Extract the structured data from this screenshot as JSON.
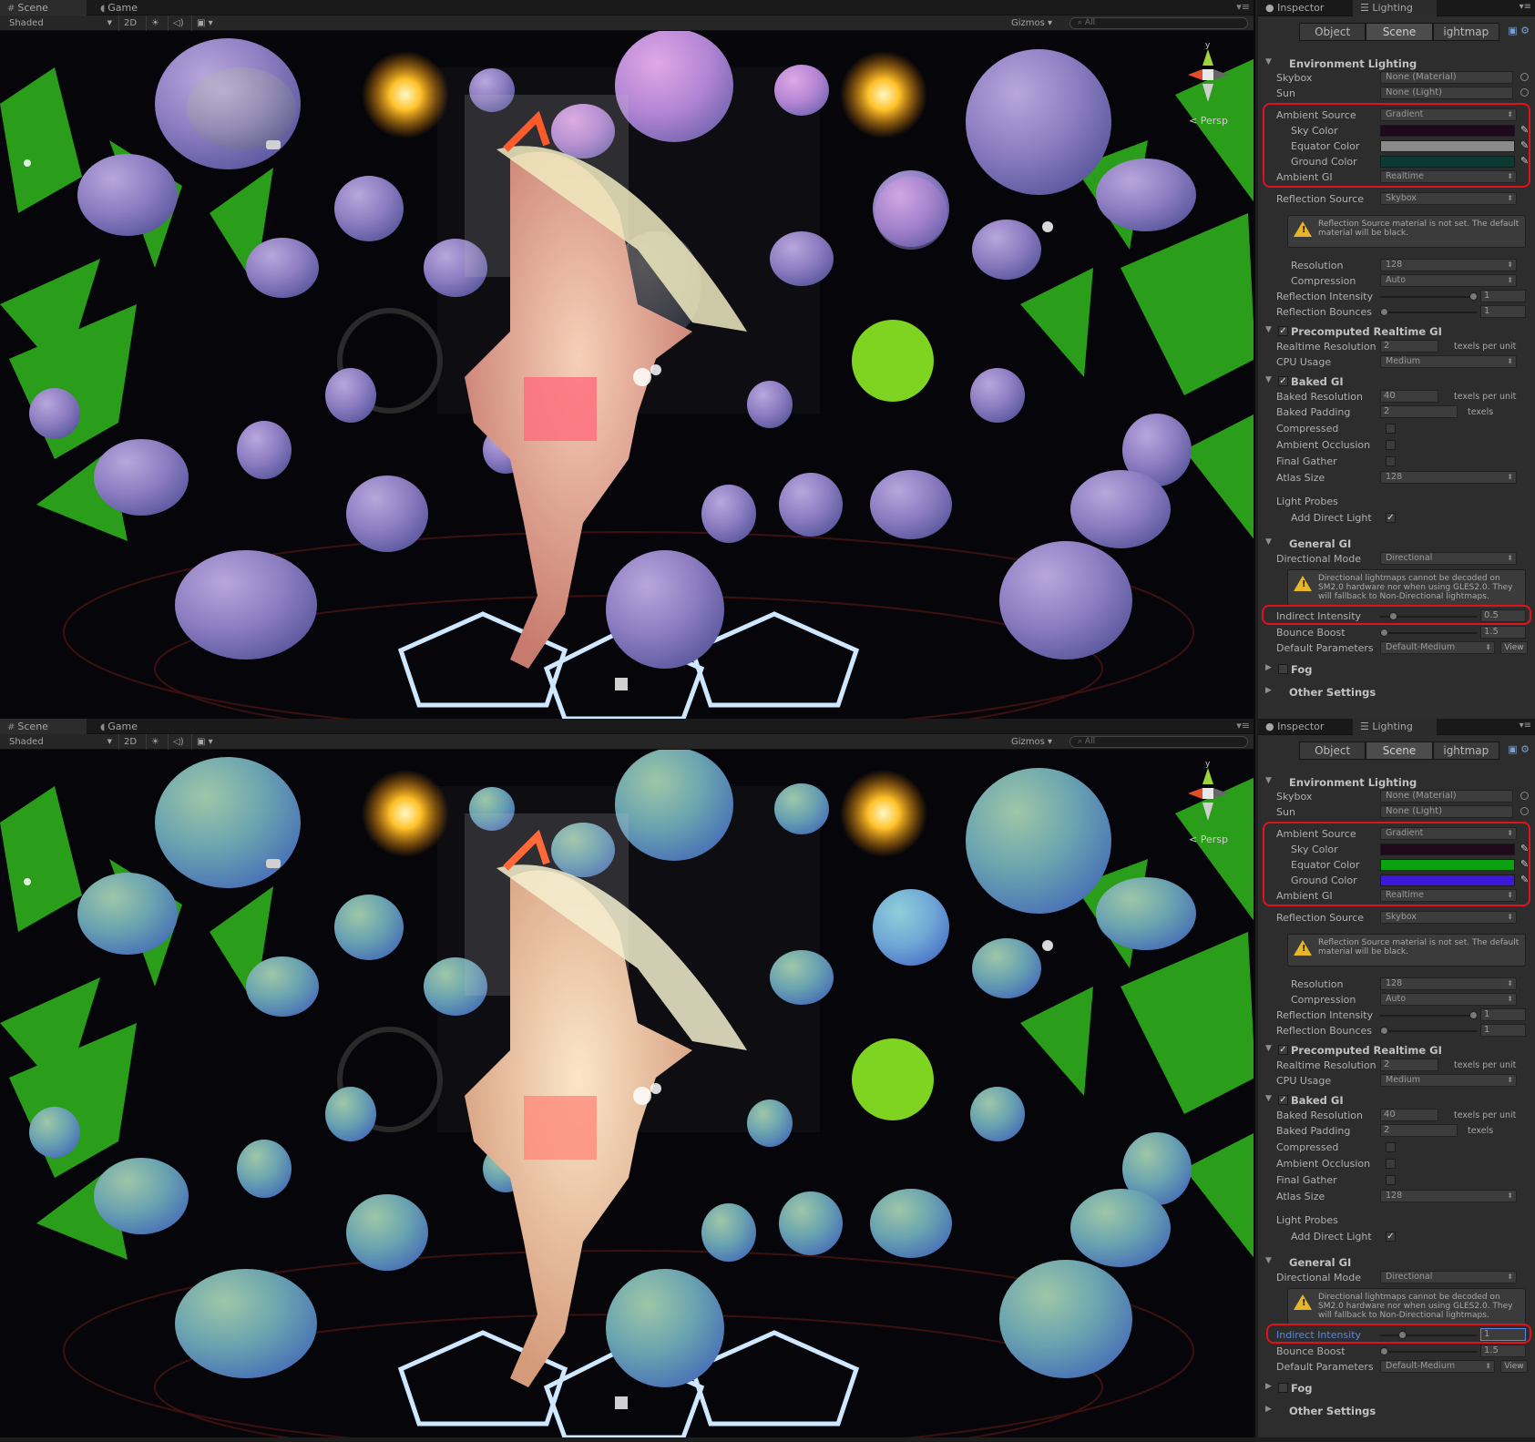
{
  "scene": {
    "tab_scene": "Scene",
    "tab_game": "Game",
    "shading_mode": "Shaded",
    "mode_2d": "2D",
    "gizmos_label": "Gizmos",
    "search_placeholder": "All",
    "persp_label": "Persp",
    "gizmo_axis_y": "y"
  },
  "panels": [
    {
      "tab_inspector": "Inspector",
      "tab_lighting": "Lighting",
      "seg_object": "Object",
      "seg_scene": "Scene",
      "seg_lightmap": "ightmap",
      "environment_header": "Environment Lighting",
      "skybox_label": "Skybox",
      "skybox_value": "None (Material)",
      "sun_label": "Sun",
      "sun_value": "None (Light)",
      "ambient_source_label": "Ambient Source",
      "ambient_source_value": "Gradient",
      "sky_color_label": "Sky Color",
      "sky_color": "#1e0a1a",
      "equator_color_label": "Equator Color",
      "equator_color": "#8a8a8a",
      "ground_color_label": "Ground Color",
      "ground_color": "#0a3a33",
      "ambient_gi_label": "Ambient GI",
      "ambient_gi_value": "Realtime",
      "reflection_source_label": "Reflection Source",
      "reflection_source_value": "Skybox",
      "reflection_warning": "Reflection Source material is not set. The default material will be black.",
      "resolution_label": "Resolution",
      "resolution_value": "128",
      "compression_label": "Compression",
      "compression_value": "Auto",
      "reflection_intensity_label": "Reflection Intensity",
      "reflection_intensity_value": "1",
      "reflection_bounces_label": "Reflection Bounces",
      "reflection_bounces_value": "1",
      "precomputed_header": "Precomputed Realtime GI",
      "realtime_resolution_label": "Realtime Resolution",
      "realtime_resolution_value": "2",
      "texels_per_unit": "texels per unit",
      "cpu_usage_label": "CPU Usage",
      "cpu_usage_value": "Medium",
      "baked_header": "Baked GI",
      "baked_resolution_label": "Baked Resolution",
      "baked_resolution_value": "40",
      "baked_padding_label": "Baked Padding",
      "baked_padding_value": "2",
      "texels": "texels",
      "compressed_label": "Compressed",
      "ambient_occlusion_label": "Ambient Occlusion",
      "final_gather_label": "Final Gather",
      "atlas_size_label": "Atlas Size",
      "atlas_size_value": "128",
      "light_probes_label": "Light Probes",
      "add_direct_light_label": "Add Direct Light",
      "general_header": "General GI",
      "directional_mode_label": "Directional Mode",
      "directional_mode_value": "Directional",
      "directional_warning": "Directional lightmaps cannot be decoded on SM2.0 hardware nor when using GLES2.0. They will fallback to Non-Directional lightmaps.",
      "indirect_intensity_label": "Indirect Intensity",
      "indirect_intensity_value": "0.5",
      "indirect_intensity_fraction": 0.1,
      "bounce_boost_label": "Bounce Boost",
      "bounce_boost_value": "1.5",
      "default_parameters_label": "Default Parameters",
      "default_parameters_value": "Default-Medium",
      "view_button": "View",
      "fog_header": "Fog",
      "other_header": "Other Settings"
    },
    {
      "tab_inspector": "Inspector",
      "tab_lighting": "Lighting",
      "seg_object": "Object",
      "seg_scene": "Scene",
      "seg_lightmap": "ightmap",
      "environment_header": "Environment Lighting",
      "skybox_label": "Skybox",
      "skybox_value": "None (Material)",
      "sun_label": "Sun",
      "sun_value": "None (Light)",
      "ambient_source_label": "Ambient Source",
      "ambient_source_value": "Gradient",
      "sky_color_label": "Sky Color",
      "sky_color": "#1e0a1a",
      "equator_color_label": "Equator Color",
      "equator_color": "#0aa20e",
      "ground_color_label": "Ground Color",
      "ground_color": "#3a1ad6",
      "ambient_gi_label": "Ambient GI",
      "ambient_gi_value": "Realtime",
      "reflection_source_label": "Reflection Source",
      "reflection_source_value": "Skybox",
      "reflection_warning": "Reflection Source material is not set. The default material will be black.",
      "resolution_label": "Resolution",
      "resolution_value": "128",
      "compression_label": "Compression",
      "compression_value": "Auto",
      "reflection_intensity_label": "Reflection Intensity",
      "reflection_intensity_value": "1",
      "reflection_bounces_label": "Reflection Bounces",
      "reflection_bounces_value": "1",
      "precomputed_header": "Precomputed Realtime GI",
      "realtime_resolution_label": "Realtime Resolution",
      "realtime_resolution_value": "2",
      "texels_per_unit": "texels per unit",
      "cpu_usage_label": "CPU Usage",
      "cpu_usage_value": "Medium",
      "baked_header": "Baked GI",
      "baked_resolution_label": "Baked Resolution",
      "baked_resolution_value": "40",
      "baked_padding_label": "Baked Padding",
      "baked_padding_value": "2",
      "texels": "texels",
      "compressed_label": "Compressed",
      "ambient_occlusion_label": "Ambient Occlusion",
      "final_gather_label": "Final Gather",
      "atlas_size_label": "Atlas Size",
      "atlas_size_value": "128",
      "light_probes_label": "Light Probes",
      "add_direct_light_label": "Add Direct Light",
      "general_header": "General GI",
      "directional_mode_label": "Directional Mode",
      "directional_mode_value": "Directional",
      "directional_warning": "Directional lightmaps cannot be decoded on SM2.0 hardware nor when using GLES2.0. They will fallback to Non-Directional lightmaps.",
      "indirect_intensity_label": "Indirect Intensity",
      "indirect_intensity_value": "1",
      "indirect_intensity_fraction": 0.2,
      "bounce_boost_label": "Bounce Boost",
      "bounce_boost_value": "1.5",
      "default_parameters_label": "Default Parameters",
      "default_parameters_value": "Default-Medium",
      "view_button": "View",
      "fog_header": "Fog",
      "other_header": "Other Settings"
    }
  ],
  "colors": {
    "highlight_box": "#e0121b",
    "top_sphere_tint": "purple",
    "bottom_sphere_tint": "teal"
  }
}
